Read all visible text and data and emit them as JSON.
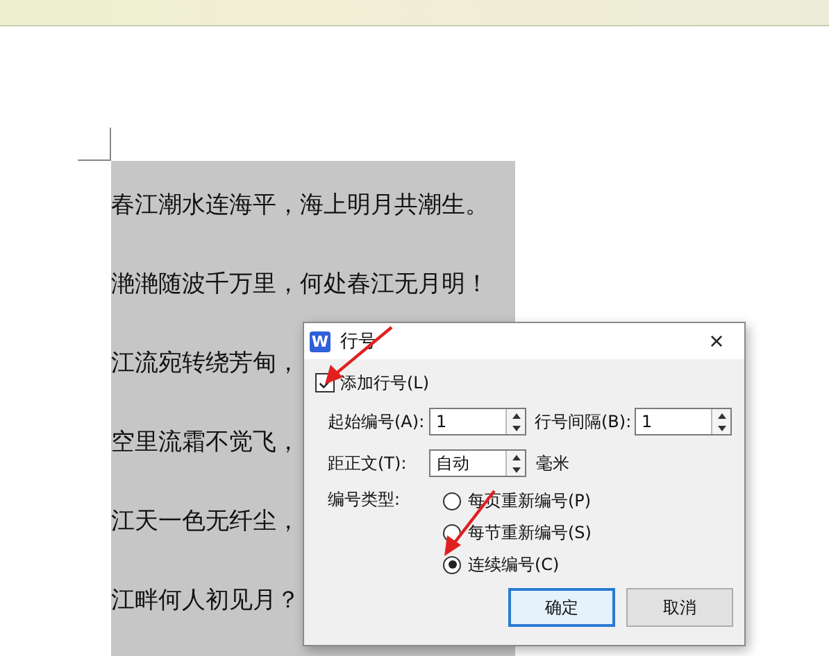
{
  "document": {
    "lines": [
      "春江潮水连海平，海上明月共潮生。",
      "滟滟随波千万里，何处春江无月明！",
      "江流宛转绕芳甸，",
      "空里流霜不觉飞，",
      "江天一色无纤尘，",
      "江畔何人初见月？"
    ]
  },
  "dialog": {
    "app_letter": "W",
    "title": "行号",
    "close": "×",
    "add_line_numbers": {
      "label": "添加行号(L)",
      "checked": true
    },
    "start_at": {
      "label": "起始编号(A):",
      "value": "1"
    },
    "count_by": {
      "label": "行号间隔(B):",
      "value": "1"
    },
    "from_text": {
      "label": "距正文(T):",
      "value": "自动",
      "unit": "毫米"
    },
    "numbering_label": "编号类型:",
    "numbering": [
      {
        "label": "每页重新编号(P)",
        "selected": false
      },
      {
        "label": "每节重新编号(S)",
        "selected": false
      },
      {
        "label": "连续编号(C)",
        "selected": true
      }
    ],
    "buttons": [
      {
        "label": "确定",
        "kind": "primary"
      },
      {
        "label": "取消",
        "kind": "normal"
      }
    ]
  }
}
